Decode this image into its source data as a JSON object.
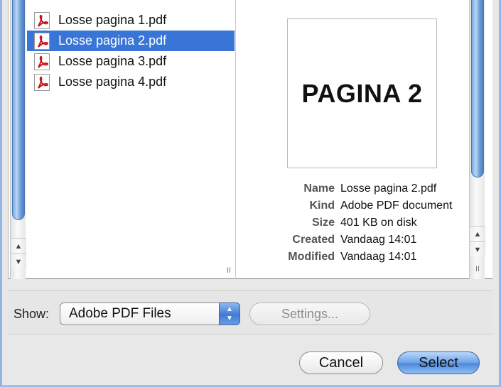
{
  "files": [
    {
      "name": "Losse pagina 1.pdf",
      "selected": false
    },
    {
      "name": "Losse pagina 2.pdf",
      "selected": true
    },
    {
      "name": "Losse pagina 3.pdf",
      "selected": false
    },
    {
      "name": "Losse pagina 4.pdf",
      "selected": false
    }
  ],
  "preview": {
    "page_text": "PAGINA 2",
    "info": [
      {
        "label": "Name",
        "value": "Losse pagina 2.pdf"
      },
      {
        "label": "Kind",
        "value": "Adobe PDF document"
      },
      {
        "label": "Size",
        "value": "401 KB on disk"
      },
      {
        "label": "Created",
        "value": "Vandaag 14:01"
      },
      {
        "label": "Modified",
        "value": "Vandaag 14:01"
      }
    ]
  },
  "show": {
    "label": "Show:",
    "selected": "Adobe PDF Files"
  },
  "buttons": {
    "settings": "Settings...",
    "cancel": "Cancel",
    "select": "Select"
  },
  "icons": {
    "file": "pdf-file-icon",
    "scroll_up": "▲",
    "scroll_down": "▼",
    "grip": "II"
  },
  "colors": {
    "selection": "#3875d7",
    "accent": "#4a86dc"
  }
}
